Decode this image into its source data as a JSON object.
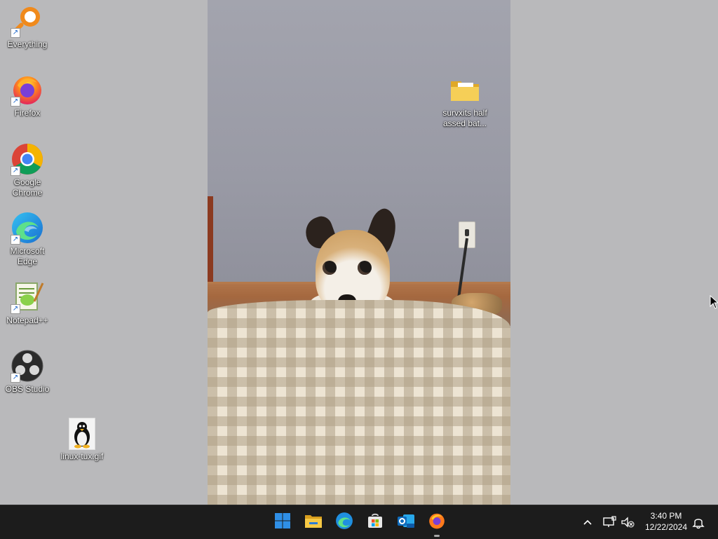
{
  "desktop": {
    "icons": [
      {
        "label": "Everything",
        "icon": "everything-search-icon"
      },
      {
        "label": "Firefox",
        "icon": "firefox-icon"
      },
      {
        "label": "Google Chrome",
        "icon": "chrome-icon"
      },
      {
        "label": "Microsoft Edge",
        "icon": "edge-icon"
      },
      {
        "label": "Notepad++",
        "icon": "notepad-plus-plus-icon"
      },
      {
        "label": "OBS Studio",
        "icon": "obs-icon"
      },
      {
        "label": "linux-tux.gif",
        "icon": "tux-penguin-icon"
      },
      {
        "label": "survxits half assed bat...",
        "icon": "folder-icon"
      }
    ],
    "shortcut_arrow": "↗"
  },
  "taskbar": {
    "apps": [
      {
        "name": "Start",
        "icon": "windows-start-icon"
      },
      {
        "name": "File Explorer",
        "icon": "file-explorer-icon"
      },
      {
        "name": "Microsoft Edge",
        "icon": "edge-icon"
      },
      {
        "name": "Microsoft Store",
        "icon": "store-icon"
      },
      {
        "name": "Outlook (new)",
        "icon": "outlook-icon"
      },
      {
        "name": "Firefox",
        "icon": "firefox-icon"
      }
    ],
    "tray": {
      "overflow_chevron": "^",
      "time": "3:40 PM",
      "date": "12/22/2024"
    }
  },
  "colors": {
    "desktop_bg": "#b9b9bb",
    "taskbar_bg": "#1c1c1c",
    "windows_blue": "#2f8fe6",
    "folder_yellow": "#f4c53d"
  }
}
